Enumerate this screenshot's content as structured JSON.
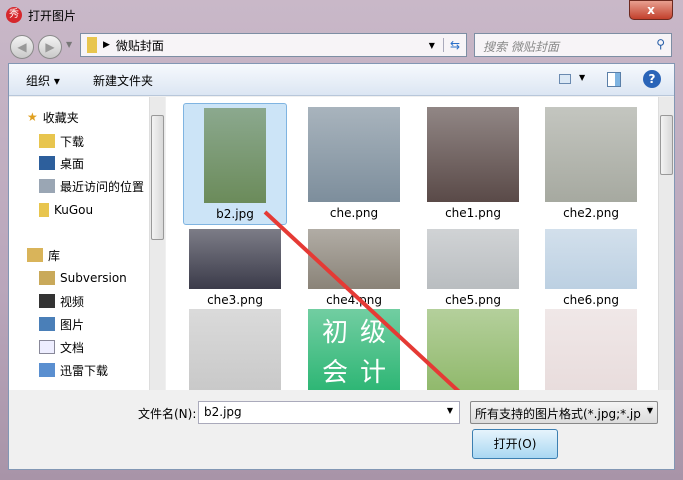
{
  "window": {
    "title": "打开图片",
    "close": "x"
  },
  "nav": {
    "path": "微贴封面",
    "search_placeholder": "搜索 微贴封面"
  },
  "toolbar": {
    "organize": "组织 ▾",
    "new_folder": "新建文件夹"
  },
  "sidebar": {
    "items": [
      {
        "label": "收藏夹",
        "icon": "star-icon"
      },
      {
        "label": "下载",
        "icon": "download-folder-icon"
      },
      {
        "label": "桌面",
        "icon": "desktop-icon"
      },
      {
        "label": "最近访问的位置",
        "icon": "recent-places-icon"
      },
      {
        "label": "KuGou",
        "icon": "folder-icon"
      },
      {
        "label": "库",
        "icon": "library-icon"
      },
      {
        "label": "Subversion",
        "icon": "library-icon"
      },
      {
        "label": "视频",
        "icon": "video-icon"
      },
      {
        "label": "图片",
        "icon": "pictures-icon"
      },
      {
        "label": "文档",
        "icon": "documents-icon"
      },
      {
        "label": "迅雷下载",
        "icon": "download-icon"
      }
    ]
  },
  "files": [
    {
      "name": "b2.jpg",
      "selected": true,
      "color": "#6b8b5a"
    },
    {
      "name": "che.png",
      "color": "#7d8e9c"
    },
    {
      "name": "che1.png",
      "color": "#5a4a48"
    },
    {
      "name": "che2.png",
      "color": "#a6a9a0"
    },
    {
      "name": "che3.png",
      "color": "#3b3b4a"
    },
    {
      "name": "che4.png",
      "color": "#8a8378"
    },
    {
      "name": "che5.png",
      "color": "#b9bdc0"
    },
    {
      "name": "che6.png",
      "color": "#bcd0e2"
    },
    {
      "name": "",
      "color": "#c8c8c8"
    },
    {
      "name": "初级会计",
      "color": "#2bb573"
    },
    {
      "name": "",
      "color": "#8fb86a"
    },
    {
      "name": "",
      "color": "#e8dcdc"
    }
  ],
  "bottom": {
    "filename_label": "文件名(N):",
    "filename_value": "b2.jpg",
    "filter": "所有支持的图片格式(*.jpg;*.jp",
    "open": "打开(O)"
  },
  "colors": {
    "arrow": "#e53a35"
  }
}
